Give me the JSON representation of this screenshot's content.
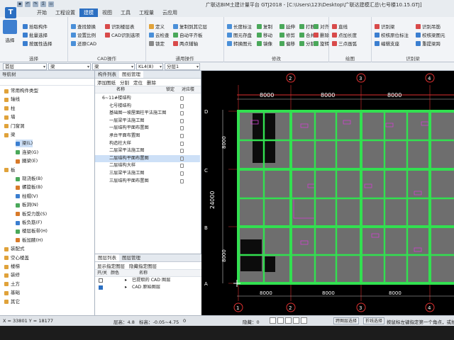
{
  "app": {
    "title": "广联达BIM土建计量平台 GTJ2018 - [C:\\Users\\123\\Desktop\\广联达建模汇总\\七号楼10.15.GTJ]",
    "logo_letter": "T"
  },
  "menu_tabs": [
    "开始",
    "工程设置",
    "建模",
    "视图",
    "工具",
    "工程量",
    "云应用"
  ],
  "active_tab": "建模",
  "ribbon": {
    "select_group": {
      "big_label": "选择",
      "items": [
        "拾取构件",
        "批量选择",
        "按属性选择"
      ],
      "label": "选择"
    },
    "cad_group": {
      "items": [
        "查找替换",
        "设置比例",
        "还原CAD",
        "识别楼层表",
        "CAD识别选项"
      ],
      "label": "CAD操作"
    },
    "general_group": {
      "items": [
        "定义",
        "复制到其它层",
        "云检查",
        "自动平齐板",
        "锁定",
        "两点辅轴"
      ],
      "label": "通用操作"
    },
    "modify_group": {
      "items": [
        "长度标注",
        "图元存盘",
        "转换图元",
        "复制",
        "延伸",
        "打断",
        "对齐",
        "移动",
        "修剪",
        "合并",
        "删除",
        "镜像",
        "偏移",
        "分割",
        "旋转"
      ],
      "label": "修改"
    },
    "draw_group": {
      "items": [
        "直线",
        "点加长度",
        "三点画弧"
      ],
      "label": "绘图"
    },
    "recognize_group": {
      "items": [
        "识别梁",
        "识别吊筋",
        "校核原位标注",
        "校核梁图元",
        "编辑支座",
        "重提梁跨"
      ],
      "label": "识别梁"
    }
  },
  "property_bar": {
    "floor": "首层",
    "category": "梁",
    "type": "梁",
    "member": "KL4(8)",
    "layer": "分层1"
  },
  "nav_panel": {
    "title": "导航树",
    "items": [
      {
        "label": "常用构件类型",
        "level": 0
      },
      {
        "label": "轴线",
        "level": 0
      },
      {
        "label": "柱",
        "level": 0
      },
      {
        "label": "墙",
        "level": 0
      },
      {
        "label": "门窗洞",
        "level": 0
      },
      {
        "label": "梁",
        "level": 0
      },
      {
        "label": "梁(L)",
        "level": 1,
        "selected": true
      },
      {
        "label": "连梁(G)",
        "level": 1
      },
      {
        "label": "圈梁(E)",
        "level": 1
      },
      {
        "label": "板",
        "level": 0
      },
      {
        "label": "现浇板(B)",
        "level": 1
      },
      {
        "label": "螺旋板(B)",
        "level": 1
      },
      {
        "label": "柱帽(V)",
        "level": 1
      },
      {
        "label": "板洞(N)",
        "level": 1
      },
      {
        "label": "板受力筋(S)",
        "level": 1
      },
      {
        "label": "板负筋(F)",
        "level": 1
      },
      {
        "label": "楼层板带(H)",
        "level": 1
      },
      {
        "label": "板加腋(H)",
        "level": 1
      },
      {
        "label": "装配式",
        "level": 0
      },
      {
        "label": "空心楼盖",
        "level": 0
      },
      {
        "label": "楼梯",
        "level": 0
      },
      {
        "label": "装修",
        "level": 0
      },
      {
        "label": "土方",
        "level": 0
      },
      {
        "label": "基础",
        "level": 0
      },
      {
        "label": "其它",
        "level": 0
      }
    ]
  },
  "draw_panel": {
    "tabs": [
      "构件列表",
      "图纸管理"
    ],
    "active_tab": "图纸管理",
    "toolbar": [
      "添加图纸",
      "分割",
      "定位",
      "删除"
    ],
    "columns": [
      "名称",
      "锁定",
      "对应楼"
    ],
    "rows": [
      {
        "label": "6~11#楼结构",
        "level": 0
      },
      {
        "label": "七号楼结构",
        "level": 1
      },
      {
        "label": "基础图一坡屋面柱平法施工图",
        "level": 1
      },
      {
        "label": "一层梁平法施工图",
        "level": 1
      },
      {
        "label": "一层结构平面布置图",
        "level": 1
      },
      {
        "label": "承台平面布置图",
        "level": 1
      },
      {
        "label": "构造柱大样",
        "level": 1
      },
      {
        "label": "二层梁平法施工图",
        "level": 1
      },
      {
        "label": "二层结构平面布置图",
        "level": 1,
        "selected": true
      },
      {
        "label": "二层结构大样",
        "level": 1
      },
      {
        "label": "三层梁平法施工图",
        "level": 1
      },
      {
        "label": "三层结构平面布置图",
        "level": 1
      }
    ],
    "layer_tabs": [
      "图层列表",
      "图层管理"
    ],
    "layer_toolbar": [
      "显示指定图层",
      "隐藏指定图层"
    ],
    "layer_columns": [
      "开/关",
      "颜色",
      "名称"
    ],
    "layers": [
      "已提取的 CAD 图层",
      "CAD 原始图层"
    ]
  },
  "canvas": {
    "dims_top": [
      "8000",
      "8000",
      "8000"
    ],
    "dim_left_total": "24000",
    "dims_left": [
      "8000",
      "8000"
    ],
    "axis_rows": [
      "D",
      "C",
      "B",
      "A"
    ],
    "axis_cols_top": [
      "2",
      "3",
      "4"
    ],
    "axis_cols_bottom": [
      "1",
      "2",
      "3",
      "4"
    ],
    "dims_bottom": [
      "8000",
      "8000",
      "8000"
    ]
  },
  "status": {
    "coords": "X = 33801 Y = 18177",
    "floor_height": "层高：4.8",
    "elevation": "标高：-0.05~4.75",
    "zero": "0",
    "hidden": "隐藏：0",
    "snap_buttons": [
      "跨图层选择",
      "折线选择",
      "按鼠标左键指定第一个角点，或拾取构件图元"
    ]
  },
  "colors": {
    "accent": "#2b6fc2",
    "beam": "#32e050",
    "grid": "#e03030",
    "canvas_bg": "#000000"
  }
}
